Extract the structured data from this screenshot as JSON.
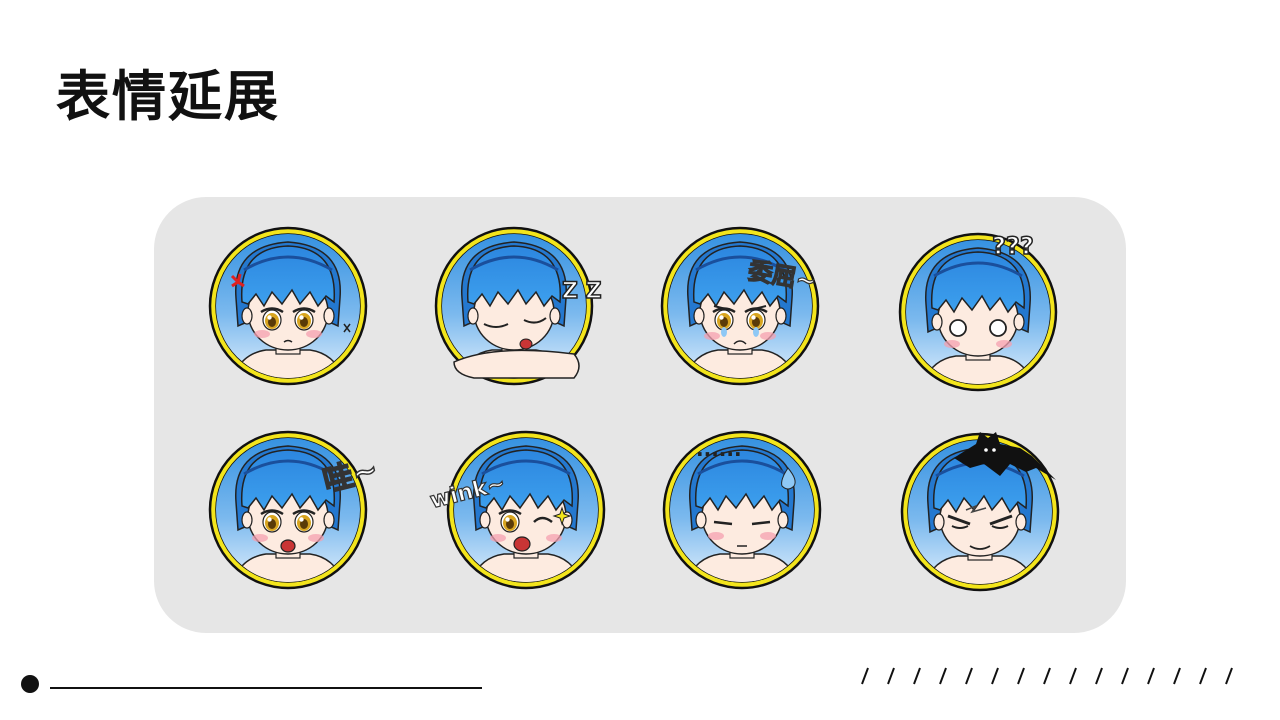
{
  "page": {
    "title": "表情延展"
  },
  "stickers": [
    {
      "name": "angry",
      "caption": ""
    },
    {
      "name": "sleepy",
      "caption": "Z Z"
    },
    {
      "name": "aggrieved",
      "caption": "委屈~"
    },
    {
      "name": "confused",
      "caption": "???"
    },
    {
      "name": "wow",
      "caption": "哇~"
    },
    {
      "name": "wink",
      "caption": "wink~"
    },
    {
      "name": "speechless",
      "caption": "......"
    },
    {
      "name": "evil",
      "caption": ""
    }
  ],
  "colors": {
    "ring": "#f3e51c",
    "hair": "#2d8fe0",
    "hair_dark": "#1f5fb5",
    "skin": "#fdebe0",
    "panel": "#e6e6e6",
    "blush": "#f4a0b0",
    "eye": "#d8a520"
  }
}
